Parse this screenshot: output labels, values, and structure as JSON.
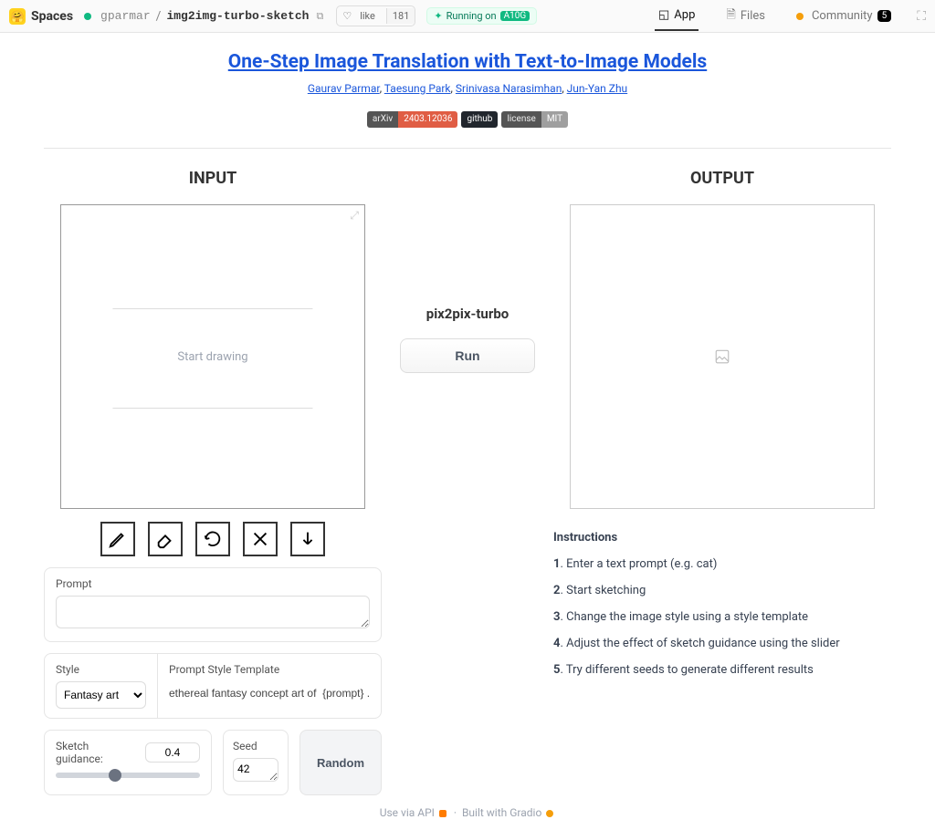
{
  "topbar": {
    "brand": "Spaces",
    "owner": "gparmar",
    "repo": "img2img-turbo-sketch",
    "like_label": "like",
    "like_count": "181",
    "running": "Running on ",
    "hardware": "A10G"
  },
  "nav": {
    "app": "App",
    "files": "Files",
    "community": "Community",
    "community_count": "5"
  },
  "header": {
    "title": "One-Step Image Translation with Text-to-Image Models",
    "authors": [
      "Gaurav Parmar",
      "Taesung Park",
      "Srinivasa Narasimhan",
      "Jun-Yan Zhu"
    ],
    "badges": {
      "arxiv_l": "arXiv",
      "arxiv_r": "2403.12036",
      "github": "github",
      "license_l": "license",
      "license_r": "MIT"
    }
  },
  "labels": {
    "input": "INPUT",
    "output": "OUTPUT",
    "start_drawing": "Start drawing",
    "mid_title": "pix2pix-turbo",
    "run": "Run",
    "prompt": "Prompt",
    "style": "Style",
    "style_template": "Prompt Style Template",
    "sketch_guidance": "Sketch guidance:",
    "seed": "Seed",
    "random": "Random"
  },
  "fields": {
    "prompt_value": "",
    "style_value": "Fantasy art",
    "template_value": "ethereal fantasy concept art of  {prompt} . mag",
    "sketch_guidance_value": "0.4",
    "seed_value": "42"
  },
  "instructions": {
    "title": "Instructions",
    "items": [
      "Enter a text prompt (e.g. cat)",
      "Start sketching",
      "Change the image style using a style template",
      "Adjust the effect of sketch guidance using the slider",
      "Try different seeds to generate different results"
    ]
  },
  "footer": {
    "api": "Use via API",
    "gradio": "Built with Gradio"
  }
}
